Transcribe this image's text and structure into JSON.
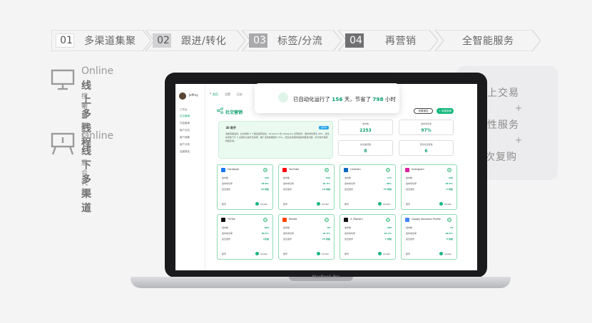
{
  "steps": [
    {
      "num": "01",
      "label": "多渠道集聚"
    },
    {
      "num": "02",
      "label": "跟进/转化"
    },
    {
      "num": "03",
      "label": "标签/分流"
    },
    {
      "num": "04",
      "label": "再营销"
    },
    {
      "num": "",
      "label": "全智能服务"
    }
  ],
  "left": {
    "online": {
      "en": "Online",
      "cn": "线上多线程",
      "sub1": "搜索引擎",
      "sub2": "平台 社交",
      "icon": "monitor-icon"
    },
    "offline": {
      "en": "Online",
      "cn": "线下多渠道",
      "sub1": "展会 代理",
      "icon": "booth-icon"
    }
  },
  "right": {
    "line1": "线上交易",
    "plus1": "+",
    "line2": "个性服务",
    "plus2": "+",
    "line3": "多频次复购"
  },
  "laptop_label": "MacBook Pro",
  "toast": {
    "pre": "已自动化运行了",
    "days": "156",
    "mid": "天，节省了",
    "hours": "798",
    "post": "小时"
  },
  "app": {
    "user": "Jeffrey",
    "sidebar": [
      "工作台",
      "社交营销",
      "内容营销",
      "客户互动",
      "客户画像",
      "客户分析",
      "运营报告"
    ],
    "tabs": [
      "首页",
      "设置",
      "历史"
    ],
    "title": "社交营销",
    "btn_outline": "查看报告",
    "btn_primary": "+ 新建营销",
    "ai": {
      "name": "AI 助手",
      "badge": "运行中",
      "text": "当前营销活动：社交媒体 3 个渠道运转良好。Facebook 和 Instagram 表现优异。发布成功率达 98%，建议在周末下午 3 点发布以提升互动率。推广活动效果提升 26%。建议在高峰时段发布更多内容，并与用户保持积极互动。"
    },
    "stats": [
      {
        "label": "发布数",
        "value": "2253"
      },
      {
        "label": "发布成功率",
        "value": "97%"
      },
      {
        "label": "在线渠道数",
        "value": "8"
      },
      {
        "label": "自动化任务数",
        "value": "6"
      }
    ],
    "cards": [
      {
        "name": "Facebook",
        "color": "#1877f2",
        "rows": [
          [
            "发布数",
            "316"
          ],
          [
            "发布成功率",
            "99.8%"
          ],
          [
            "最近发布",
            "10 时前"
          ]
        ],
        "foot": "账号",
        "agent": "Xorder"
      },
      {
        "name": "YouTube",
        "color": "#ff0000",
        "rows": [
          [
            "发布数",
            "265"
          ],
          [
            "发布成功率",
            "91.5%"
          ],
          [
            "最近发布",
            "10 时前"
          ]
        ],
        "foot": "账号",
        "agent": "Xorder"
      },
      {
        "name": "LinkedIn",
        "color": "#0a66c2",
        "rows": [
          [
            "发布数",
            "377"
          ],
          [
            "发布成功率",
            "99%"
          ],
          [
            "最近发布",
            "15 时前"
          ]
        ],
        "foot": "账号",
        "agent": "Xorder"
      },
      {
        "name": "Instagram",
        "color": "#d6249f",
        "rows": [
          [
            "发布数",
            "328"
          ],
          [
            "发布成功率",
            "89.5%"
          ],
          [
            "最近发布",
            "5 时前"
          ]
        ],
        "foot": "账号",
        "agent": "Xorder"
      },
      {
        "name": "TikTok",
        "color": "#111111",
        "rows": [
          [
            "发布数",
            "903"
          ],
          [
            "发布成功率",
            "90.5%"
          ],
          [
            "最近发布",
            "1天前"
          ]
        ],
        "foot": "账号",
        "agent": "Xorder"
      },
      {
        "name": "Reddit",
        "color": "#ff4500",
        "rows": [
          [
            "发布数",
            "84"
          ],
          [
            "发布成功率",
            "91.5%"
          ],
          [
            "最近发布",
            "23 时前"
          ]
        ],
        "foot": "账号",
        "agent": "Xorder"
      },
      {
        "name": "X (Twitter)",
        "color": "#111111",
        "rows": [
          [
            "发布数",
            "283"
          ],
          [
            "发布成功率",
            "91.2%"
          ],
          [
            "最近发布",
            "7 时前"
          ]
        ],
        "foot": "账号",
        "agent": "Xorder"
      },
      {
        "name": "Google Business Profile",
        "color": "#4285f4",
        "rows": [
          [
            "发布数",
            "76"
          ],
          [
            "发布成功率",
            "98.5%"
          ],
          [
            "最近发布",
            "5 时前"
          ]
        ],
        "foot": "账号",
        "agent": "Xorder"
      }
    ]
  }
}
